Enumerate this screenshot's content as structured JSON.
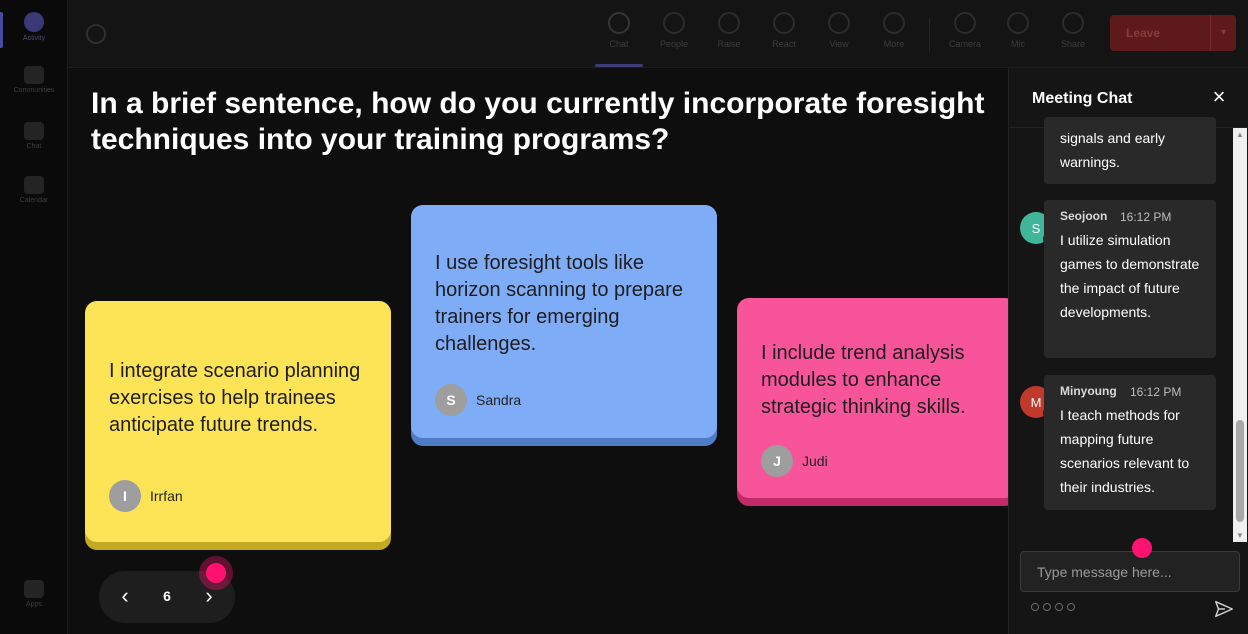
{
  "rail": {
    "items": [
      {
        "label": "Activity"
      },
      {
        "label": "Communities"
      },
      {
        "label": "Chat"
      },
      {
        "label": "Calendar"
      },
      {
        "label": "Apps"
      }
    ]
  },
  "toolbar": {
    "buttons": [
      {
        "label": "Chat",
        "icon": "chat-icon"
      },
      {
        "label": "People",
        "icon": "people-icon"
      },
      {
        "label": "Raise",
        "icon": "raise-hand-icon"
      },
      {
        "label": "React",
        "icon": "react-icon"
      },
      {
        "label": "View",
        "icon": "view-icon"
      },
      {
        "label": "More",
        "icon": "more-icon"
      },
      {
        "label": "Camera",
        "icon": "camera-icon"
      },
      {
        "label": "Mic",
        "icon": "mic-icon"
      },
      {
        "label": "Share",
        "icon": "share-icon"
      }
    ],
    "leave_label": "Leave"
  },
  "stage": {
    "question": "In a brief sentence, how do you currently incorporate foresight techniques into your training programs?",
    "cards": [
      {
        "text": "I integrate scenario planning exercises to help trainees anticipate future trends.",
        "initial": "I",
        "author": "Irrfan",
        "color": "#fde456"
      },
      {
        "text": "I use foresight tools like horizon scanning to prepare trainers for emerging challenges.",
        "initial": "S",
        "author": "Sandra",
        "color": "#7facf7"
      },
      {
        "text": "I include trend analysis modules to enhance strategic thinking skills.",
        "initial": "J",
        "author": "Judi",
        "color": "#f8549a"
      }
    ],
    "pager": {
      "page": "6"
    }
  },
  "chat": {
    "title": "Meeting Chat",
    "messages": [
      {
        "name": "",
        "time": "",
        "text": "signals and early warnings.",
        "initial": "",
        "avatar_color": ""
      },
      {
        "name": "Seojoon",
        "time": "16:12 PM",
        "text": "I utilize simulation games to demonstrate the impact of future developments.",
        "initial": "S",
        "avatar_color": "#3fb59a"
      },
      {
        "name": "Minyoung",
        "time": "16:12 PM",
        "text": "I teach methods for mapping future scenarios relevant to their industries.",
        "initial": "M",
        "avatar_color": "#c0392b"
      }
    ],
    "input_placeholder": "Type message here..."
  }
}
